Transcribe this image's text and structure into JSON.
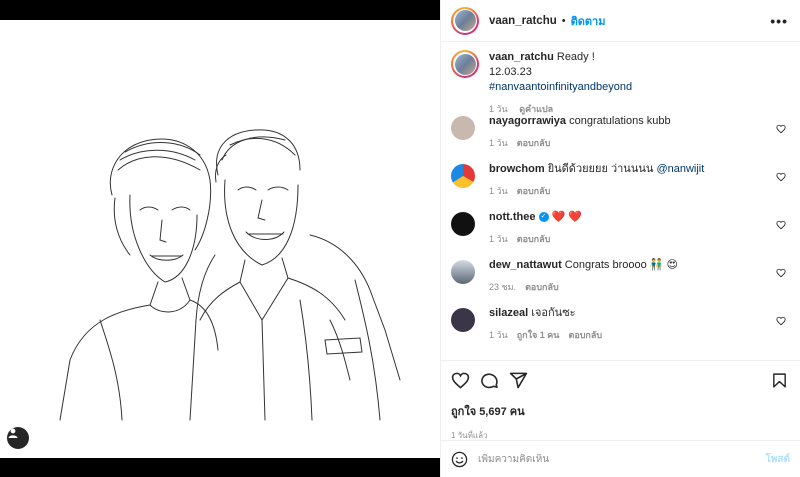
{
  "header": {
    "username": "vaan_ratchu",
    "separator": "•",
    "follow_label": "ติดตาม",
    "more_icon": "more-icon"
  },
  "caption": {
    "username": "vaan_ratchu",
    "text": "Ready !",
    "line2": "12.03.23",
    "hashtag": "#nanvaantoinfinityandbeyond",
    "age": "1 วัน",
    "translate": "ดูคำแปล"
  },
  "comments": [
    {
      "username": "nayagorrawiya",
      "text": "congratulations kubb",
      "age": "1 วัน",
      "reply": "ตอบกลับ",
      "avatar_color": "#c8b8ad"
    },
    {
      "username": "browchom",
      "text": "ยินดีด้วยยยย ว่านนนน ",
      "mention": "@nanwijit",
      "age": "1 วัน",
      "reply": "ตอบกลับ",
      "avatar_color": "#e53935"
    },
    {
      "username": "nott.thee",
      "text": "❤️ ❤️",
      "age": "1 วัน",
      "reply": "ตอบกลับ",
      "avatar_color": "#111111"
    },
    {
      "username": "dew_nattawut",
      "text": "Congrats broooo 👬 😍",
      "age": "23 ชม.",
      "reply": "ตอบกลับ",
      "avatar_color": "#6f7a8a"
    },
    {
      "username": "silazeal",
      "text": "เจอกันซะ",
      "age": "1 วัน",
      "likes": "ถูกใจ 1 คน",
      "reply": "ตอบกลับ",
      "avatar_color": "#3a3547"
    }
  ],
  "actions": {
    "like_icon": "heart-icon",
    "comment_icon": "comment-icon",
    "share_icon": "share-icon",
    "save_icon": "bookmark-icon",
    "likes_text": "ถูกใจ 5,697 คน",
    "time_text": "1 วันที่แล้ว"
  },
  "add_comment": {
    "placeholder": "เพิ่มความคิดเห็น",
    "post_label": "โพสต์"
  },
  "colors": {
    "accent": "#0095f6",
    "link": "#00376b",
    "muted": "#8e8e8e"
  }
}
